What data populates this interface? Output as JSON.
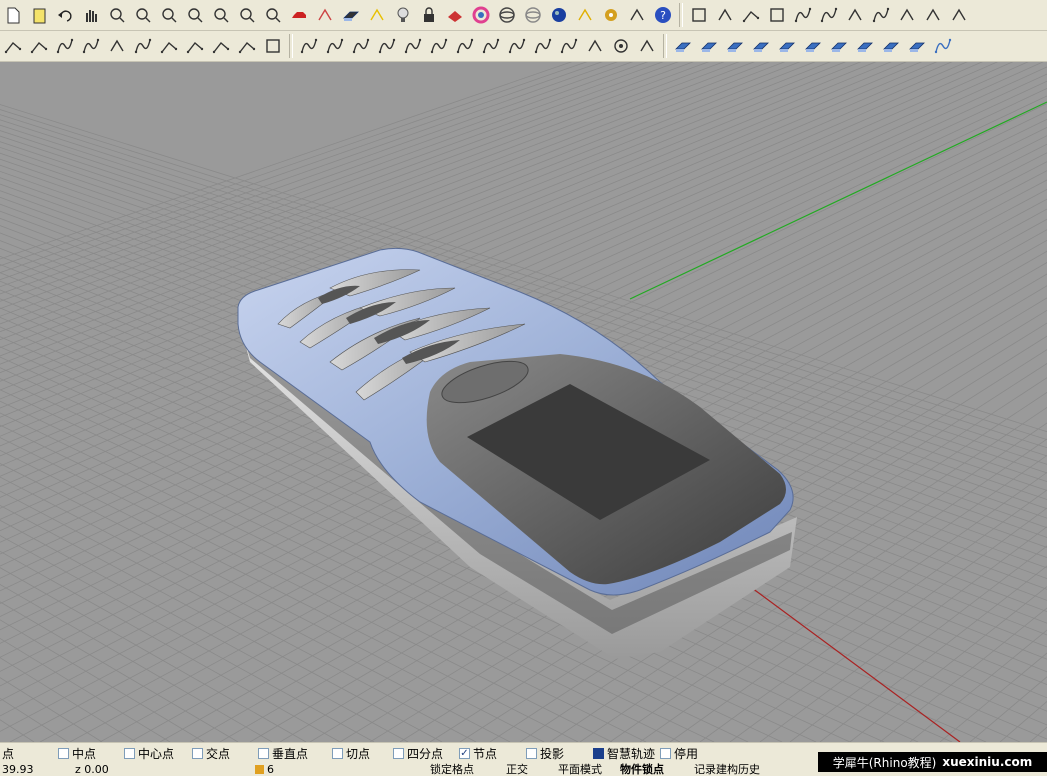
{
  "toolbar_row1": [
    {
      "icon": "new-file-icon",
      "color": "#ffffff"
    },
    {
      "icon": "clipboard-icon",
      "color": "#f4e36a"
    },
    {
      "icon": "undo-icon",
      "color": "#222222"
    },
    {
      "icon": "pan-hand-icon",
      "color": "#ffffff"
    },
    {
      "icon": "rotate-view-icon",
      "color": "#333333"
    },
    {
      "icon": "zoom-icon",
      "color": "#333333"
    },
    {
      "icon": "zoom-window-icon",
      "color": "#333333"
    },
    {
      "icon": "zoom-extents-icon",
      "color": "#333333"
    },
    {
      "icon": "zoom-selected-icon",
      "color": "#333333"
    },
    {
      "icon": "undo-view-icon",
      "color": "#333333"
    },
    {
      "icon": "four-viewports-icon",
      "color": "#333333"
    },
    {
      "icon": "car-render-icon",
      "color": "#cc2222"
    },
    {
      "icon": "texture-icon",
      "color": "#cc4444"
    },
    {
      "icon": "cplane-icon",
      "color": "#333333"
    },
    {
      "icon": "snap-star-icon",
      "color": "#e8c000"
    },
    {
      "icon": "light-bulb-icon",
      "color": "#dddddd"
    },
    {
      "icon": "lock-icon",
      "color": "#333333"
    },
    {
      "icon": "layer-icon",
      "color": "#cc3333"
    },
    {
      "icon": "color-wheel-icon",
      "color": "#e04090"
    },
    {
      "icon": "wireframe-sphere-icon",
      "color": "#444444"
    },
    {
      "icon": "shaded-sphere-icon",
      "color": "#888888"
    },
    {
      "icon": "rendered-sphere-icon",
      "color": "#1a3fa0"
    },
    {
      "icon": "select-arrow-icon",
      "color": "#e0b000"
    },
    {
      "icon": "settings-gear-icon",
      "color": "#d4a020"
    },
    {
      "icon": "dimension-icon",
      "color": "#333333"
    },
    {
      "icon": "help-icon",
      "color": "#2a4fc0"
    },
    {
      "sep": true
    },
    {
      "icon": "grid-icon",
      "color": "#333333"
    },
    {
      "icon": "xyz-point-icon",
      "color": "#333333"
    },
    {
      "icon": "line-segment-icon",
      "color": "#333333"
    },
    {
      "icon": "rectangle-icon",
      "color": "#333333"
    },
    {
      "icon": "curve-alpha-icon",
      "color": "#333333"
    },
    {
      "icon": "curve-point-icon",
      "color": "#333333"
    },
    {
      "icon": "rebuild-icon",
      "color": "#333333"
    },
    {
      "icon": "blend-curve-icon",
      "color": "#333333"
    },
    {
      "icon": "g2-icon",
      "color": "#333333"
    },
    {
      "icon": "symmetry-icon",
      "color": "#333333"
    },
    {
      "icon": "text-icon",
      "color": "#333333"
    }
  ],
  "toolbar_row2": [
    {
      "icon": "polyline-icon"
    },
    {
      "icon": "line-icon"
    },
    {
      "icon": "control-curve-icon"
    },
    {
      "icon": "interp-curve-icon"
    },
    {
      "icon": "sketch-icon"
    },
    {
      "icon": "arc-icon"
    },
    {
      "icon": "tangent-line-icon"
    },
    {
      "icon": "perp-line-icon"
    },
    {
      "icon": "angle-line-icon"
    },
    {
      "icon": "bisector-icon"
    },
    {
      "icon": "polygon-icon"
    },
    {
      "sep": true
    },
    {
      "icon": "fillet-curve-icon"
    },
    {
      "icon": "chamfer-curve-icon"
    },
    {
      "icon": "offset-curve-icon"
    },
    {
      "icon": "blend-icon"
    },
    {
      "icon": "match-curve-icon"
    },
    {
      "icon": "rebuild-curve-icon"
    },
    {
      "icon": "spiral-icon"
    },
    {
      "icon": "project-curve-icon"
    },
    {
      "icon": "pull-curve-icon"
    },
    {
      "icon": "curve-u-icon"
    },
    {
      "icon": "curve-l-icon"
    },
    {
      "icon": "hatch-icon"
    },
    {
      "icon": "circle-target-icon"
    },
    {
      "icon": "trim-icon"
    },
    {
      "sep": true
    },
    {
      "icon": "extrude-icon",
      "color": "#3a6fc0"
    },
    {
      "icon": "surface-icon",
      "color": "#3a6fc0"
    },
    {
      "icon": "plane-icon",
      "color": "#3a6fc0"
    },
    {
      "icon": "loft-icon",
      "color": "#3a6fc0"
    },
    {
      "icon": "box-icon",
      "color": "#3a6fc0"
    },
    {
      "icon": "sweep-icon",
      "color": "#3a6fc0"
    },
    {
      "icon": "patch-icon",
      "color": "#3a6fc0"
    },
    {
      "icon": "revolve-icon",
      "color": "#3a6fc0"
    },
    {
      "icon": "network-icon",
      "color": "#3a6fc0"
    },
    {
      "icon": "offset-srf-icon",
      "color": "#3a6fc0"
    },
    {
      "icon": "blend-srf-icon",
      "color": "#3a6fc0"
    }
  ],
  "viewport": {
    "background": "#9a9a9a",
    "grid_color": "#8a8a8a",
    "x_axis_color": "#aa2222",
    "y_axis_color": "#22aa22",
    "phone_body_color": "#a6b8db",
    "phone_screen_color": "#3a3a3a"
  },
  "osnap": {
    "items": [
      {
        "label": "点",
        "checked": false,
        "show_box": false
      },
      {
        "label": "中点",
        "checked": false,
        "show_box": true
      },
      {
        "label": "中心点",
        "checked": false,
        "show_box": true
      },
      {
        "label": "交点",
        "checked": false,
        "show_box": true
      },
      {
        "label": "垂直点",
        "checked": false,
        "show_box": true
      },
      {
        "label": "切点",
        "checked": false,
        "show_box": true
      },
      {
        "label": "四分点",
        "checked": false,
        "show_box": true
      },
      {
        "label": "节点",
        "checked": true,
        "show_box": true
      },
      {
        "label": "投影",
        "checked": false,
        "show_box": true
      },
      {
        "label": "智慧轨迹",
        "checked": true,
        "filled": true,
        "show_box": true
      },
      {
        "label": "停用",
        "checked": false,
        "show_box": true
      }
    ]
  },
  "statusbar": {
    "x_coord": "39.93",
    "z_coord": "z 0.00",
    "layer_color": "#e0a020",
    "layer": "6",
    "grid_snap": "锁定格点",
    "ortho": "正交",
    "planar": "平面模式",
    "osnap": "物件锁点",
    "history": "记录建构历史"
  },
  "watermark": {
    "cn": "学犀牛(Rhino教程)",
    "url": "xuexiniu.com"
  }
}
